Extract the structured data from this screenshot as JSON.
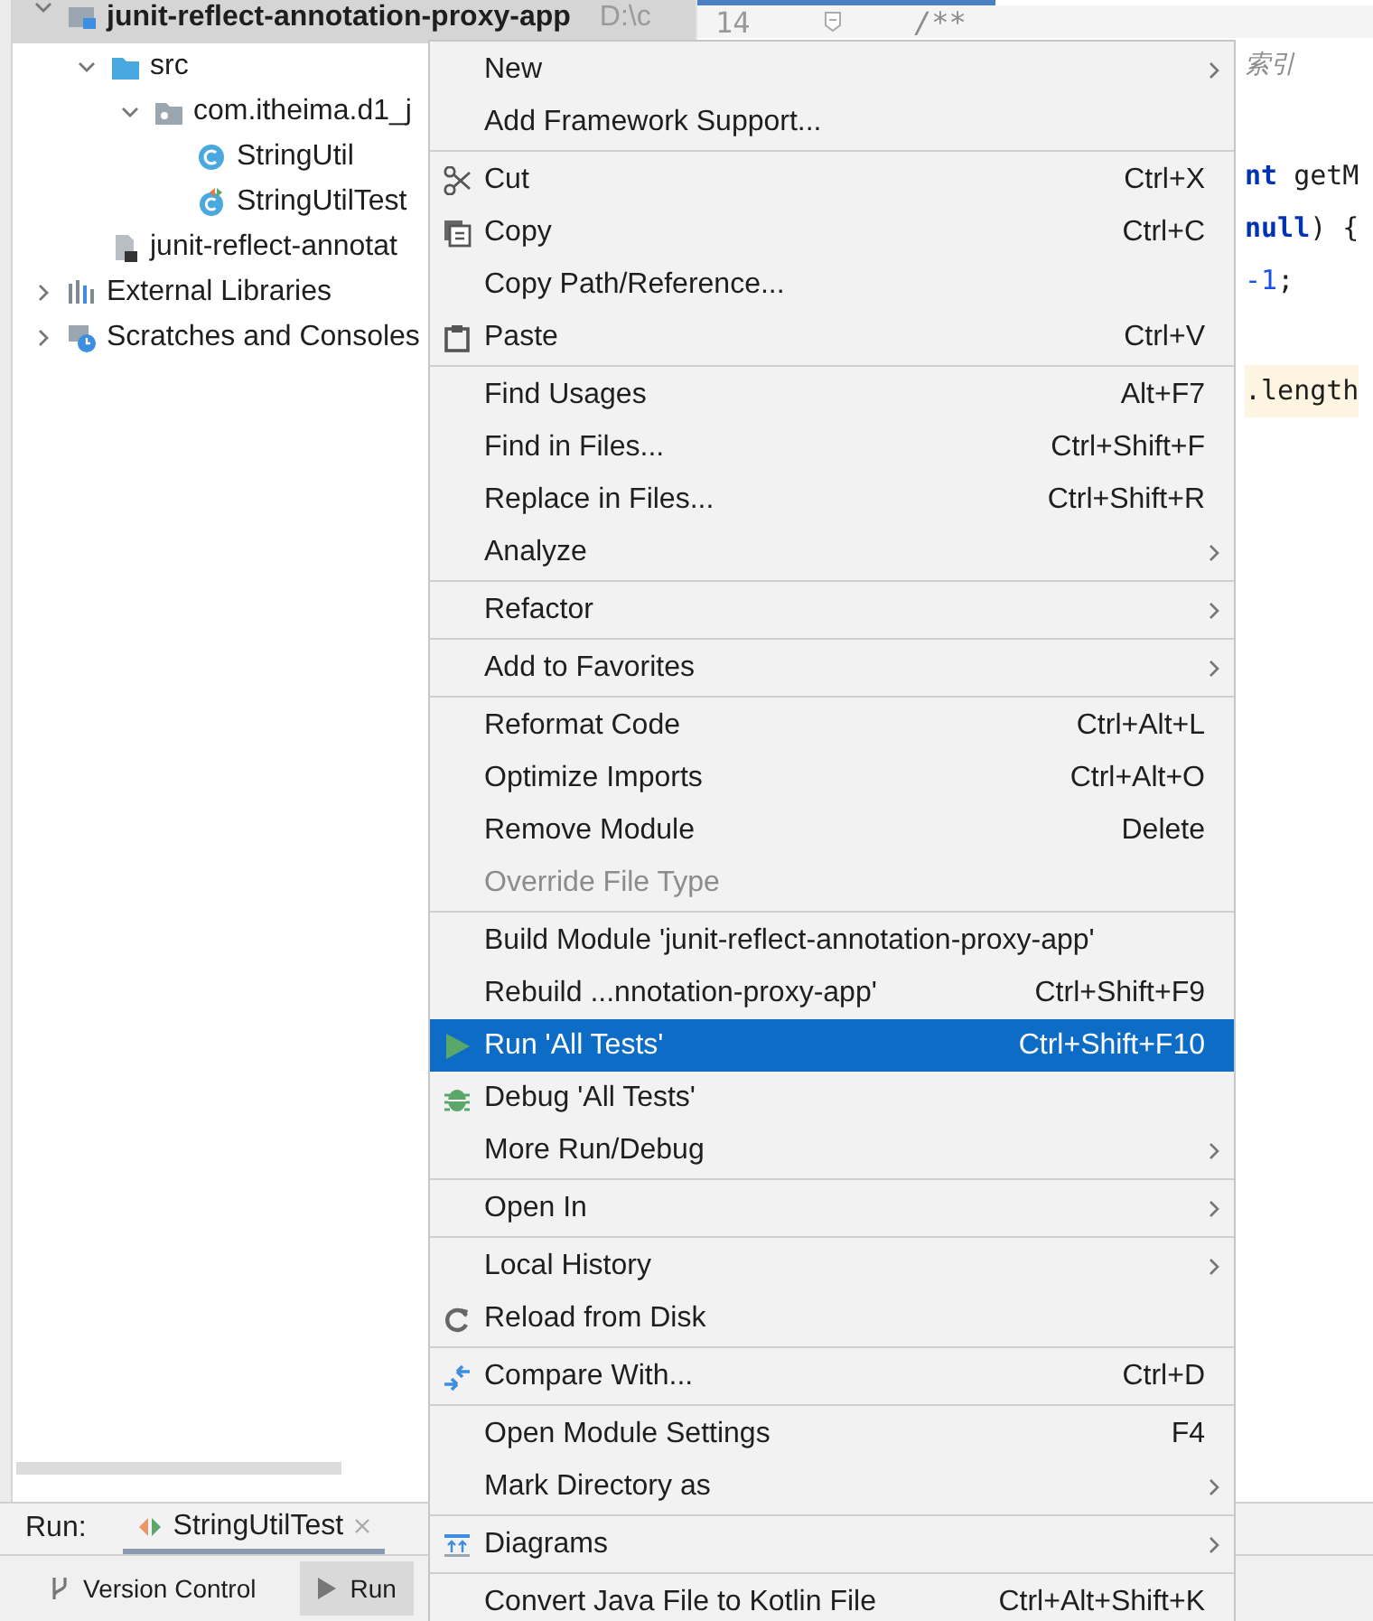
{
  "project_tree": {
    "items": [
      {
        "label": "junit-reflect-annotation-proxy-app",
        "path": "D:\\c",
        "kind": "module",
        "expanded": true,
        "selected": true,
        "children": [
          {
            "label": "src",
            "kind": "folder",
            "expanded": true,
            "selected": false,
            "children": [
              {
                "label": "com.itheima.d1_j",
                "kind": "package",
                "expanded": true,
                "selected": false,
                "children": [
                  {
                    "label": "StringUtil",
                    "kind": "class",
                    "selected": false
                  },
                  {
                    "label": "StringUtilTest",
                    "kind": "test-class",
                    "selected": false
                  }
                ]
              }
            ]
          },
          {
            "label": "junit-reflect-annotat",
            "kind": "iml-file",
            "selected": false
          }
        ]
      },
      {
        "label": "External Libraries",
        "kind": "libraries",
        "expanded": false,
        "selected": false
      },
      {
        "label": "Scratches and Consoles",
        "kind": "scratches",
        "expanded": false,
        "selected": false
      }
    ]
  },
  "editor": {
    "line_number": "14",
    "first_line": "/**",
    "lines": [
      {
        "kind": "comment",
        "tokens": [
          {
            "kind": "comment",
            "text": "索引"
          }
        ]
      },
      {
        "kind": "code",
        "tokens": [
          {
            "kind": "keyword",
            "text": "nt"
          },
          {
            "kind": "plain",
            "text": " getM"
          }
        ]
      },
      {
        "kind": "code",
        "tokens": [
          {
            "kind": "keyword",
            "text": "null"
          },
          {
            "kind": "plain",
            "text": ") {"
          }
        ]
      },
      {
        "kind": "code",
        "tokens": [
          {
            "kind": "number",
            "text": "-1"
          },
          {
            "kind": "plain",
            "text": ";"
          }
        ]
      },
      {
        "kind": "highlighted",
        "tokens": [
          {
            "kind": "plain",
            "text": ".length"
          }
        ]
      }
    ]
  },
  "context_menu": {
    "groups": [
      {
        "items": [
          {
            "label": "New",
            "kind": "plain",
            "submenu": true,
            "disabled": false,
            "selected": false
          },
          {
            "label": "Add Framework Support...",
            "kind": "plain",
            "submenu": false,
            "disabled": false,
            "selected": false
          }
        ]
      },
      {
        "items": [
          {
            "label": "Cut",
            "shortcut": "Ctrl+X",
            "kind": "cut",
            "submenu": false,
            "disabled": false,
            "selected": false
          },
          {
            "label": "Copy",
            "shortcut": "Ctrl+C",
            "kind": "copy",
            "submenu": false,
            "disabled": false,
            "selected": false
          },
          {
            "label": "Copy Path/Reference...",
            "kind": "plain",
            "submenu": false,
            "disabled": false,
            "selected": false
          },
          {
            "label": "Paste",
            "shortcut": "Ctrl+V",
            "kind": "paste",
            "submenu": false,
            "disabled": false,
            "selected": false
          }
        ]
      },
      {
        "items": [
          {
            "label": "Find Usages",
            "shortcut": "Alt+F7",
            "kind": "plain",
            "submenu": false,
            "disabled": false,
            "selected": false
          },
          {
            "label": "Find in Files...",
            "shortcut": "Ctrl+Shift+F",
            "kind": "plain",
            "submenu": false,
            "disabled": false,
            "selected": false
          },
          {
            "label": "Replace in Files...",
            "shortcut": "Ctrl+Shift+R",
            "kind": "plain",
            "submenu": false,
            "disabled": false,
            "selected": false
          },
          {
            "label": "Analyze",
            "kind": "plain",
            "submenu": true,
            "disabled": false,
            "selected": false
          }
        ]
      },
      {
        "items": [
          {
            "label": "Refactor",
            "kind": "plain",
            "submenu": true,
            "disabled": false,
            "selected": false
          }
        ]
      },
      {
        "items": [
          {
            "label": "Add to Favorites",
            "kind": "plain",
            "submenu": true,
            "disabled": false,
            "selected": false
          }
        ]
      },
      {
        "items": [
          {
            "label": "Reformat Code",
            "shortcut": "Ctrl+Alt+L",
            "kind": "plain",
            "submenu": false,
            "disabled": false,
            "selected": false
          },
          {
            "label": "Optimize Imports",
            "shortcut": "Ctrl+Alt+O",
            "kind": "plain",
            "submenu": false,
            "disabled": false,
            "selected": false
          },
          {
            "label": "Remove Module",
            "shortcut": "Delete",
            "kind": "plain",
            "submenu": false,
            "disabled": false,
            "selected": false
          },
          {
            "label": "Override File Type",
            "kind": "plain",
            "submenu": false,
            "disabled": true,
            "selected": false
          }
        ]
      },
      {
        "items": [
          {
            "label": "Build Module 'junit-reflect-annotation-proxy-app'",
            "kind": "plain",
            "submenu": false,
            "disabled": false,
            "selected": false
          },
          {
            "label": "Rebuild ...nnotation-proxy-app'",
            "shortcut": "Ctrl+Shift+F9",
            "kind": "plain",
            "submenu": false,
            "disabled": false,
            "selected": false
          },
          {
            "label": "Run 'All Tests'",
            "shortcut": "Ctrl+Shift+F10",
            "kind": "run",
            "submenu": false,
            "disabled": false,
            "selected": true
          },
          {
            "label": "Debug 'All Tests'",
            "kind": "debug",
            "submenu": false,
            "disabled": false,
            "selected": false
          },
          {
            "label": "More Run/Debug",
            "kind": "plain",
            "submenu": true,
            "disabled": false,
            "selected": false
          }
        ]
      },
      {
        "items": [
          {
            "label": "Open In",
            "kind": "plain",
            "submenu": true,
            "disabled": false,
            "selected": false
          }
        ]
      },
      {
        "items": [
          {
            "label": "Local History",
            "kind": "plain",
            "submenu": true,
            "disabled": false,
            "selected": false
          },
          {
            "label": "Reload from Disk",
            "kind": "reload",
            "submenu": false,
            "disabled": false,
            "selected": false
          }
        ]
      },
      {
        "items": [
          {
            "label": "Compare With...",
            "shortcut": "Ctrl+D",
            "kind": "compare",
            "submenu": false,
            "disabled": false,
            "selected": false
          }
        ]
      },
      {
        "items": [
          {
            "label": "Open Module Settings",
            "shortcut": "F4",
            "kind": "plain",
            "submenu": false,
            "disabled": false,
            "selected": false
          },
          {
            "label": "Mark Directory as",
            "kind": "plain",
            "submenu": true,
            "disabled": false,
            "selected": false
          }
        ]
      },
      {
        "items": [
          {
            "label": "Diagrams",
            "kind": "diagrams",
            "submenu": true,
            "disabled": false,
            "selected": false
          }
        ]
      },
      {
        "items": [
          {
            "label": "Convert Java File to Kotlin File",
            "shortcut": "Ctrl+Alt+Shift+K",
            "kind": "plain",
            "submenu": false,
            "disabled": false,
            "selected": false
          }
        ]
      }
    ]
  },
  "run_bar": {
    "label": "Run:",
    "tabs": [
      {
        "label": "StringUtilTest",
        "selected": true,
        "closable": true
      }
    ]
  },
  "tool_bar": {
    "buttons": [
      {
        "label": "Version Control",
        "kind": "vcs",
        "selected": false
      },
      {
        "label": "Run",
        "kind": "run",
        "selected": true
      }
    ]
  }
}
